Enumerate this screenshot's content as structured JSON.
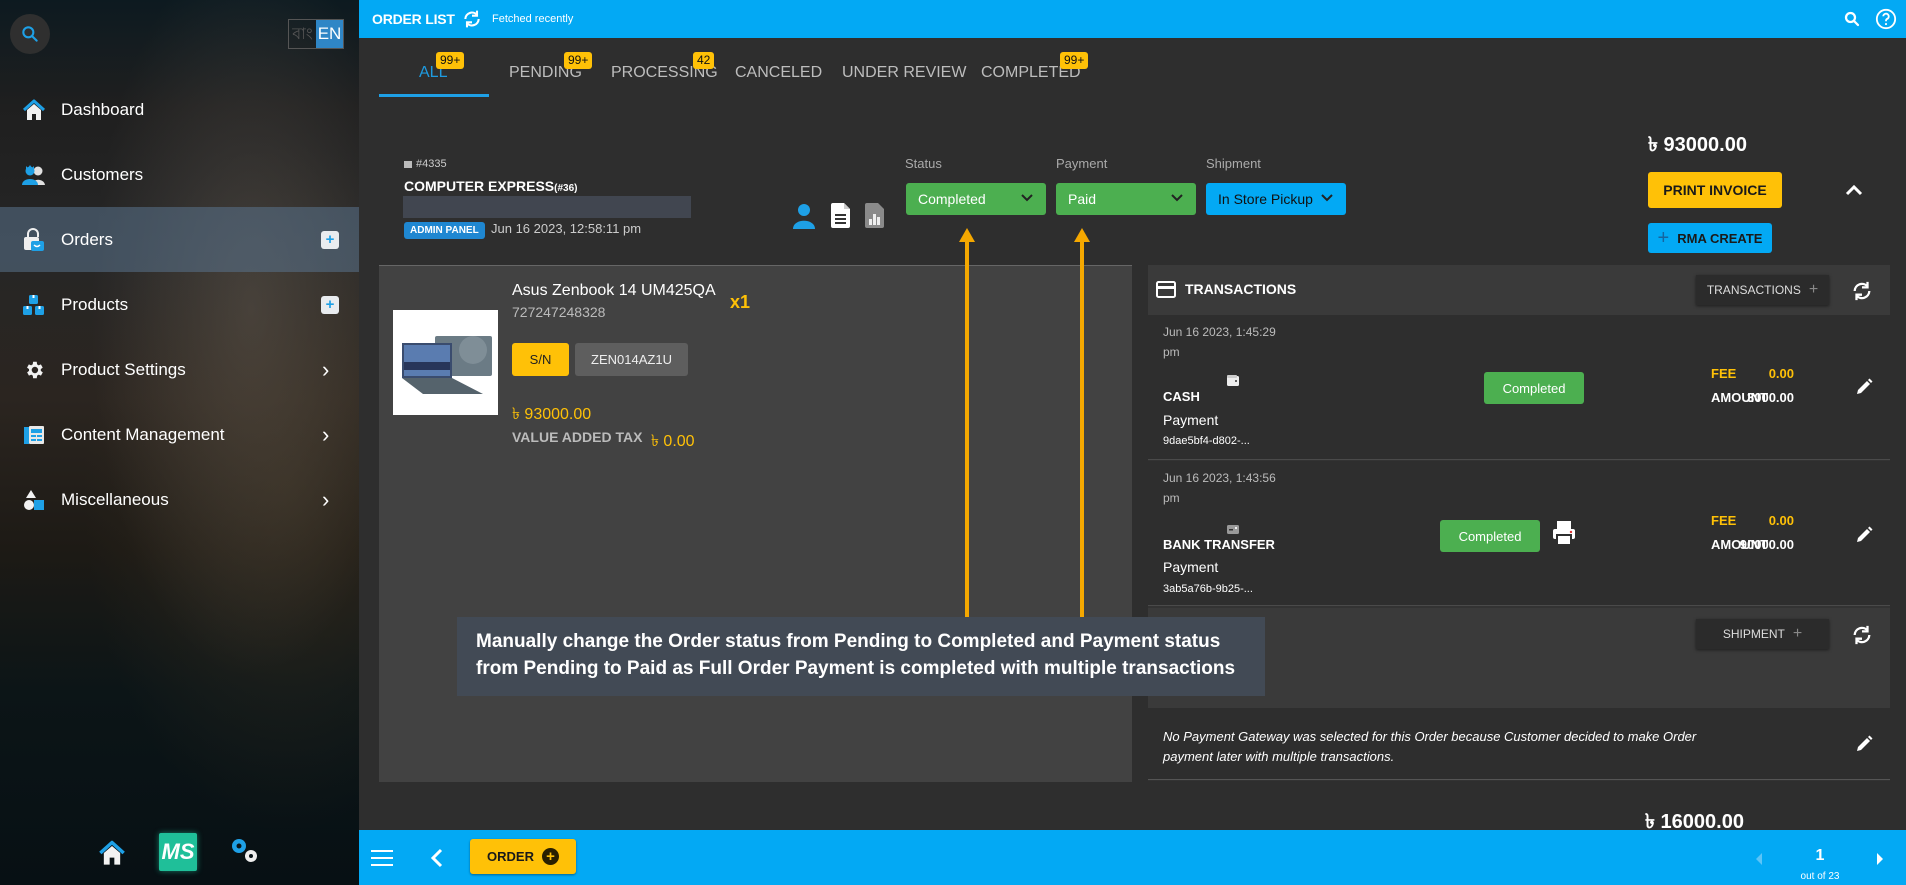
{
  "sidebar": {
    "search_icon": "search-icon",
    "lang": {
      "bn": "বাং",
      "en": "EN",
      "active": "EN"
    },
    "items": [
      {
        "label": "Dashboard",
        "icon": "home-icon",
        "action": "none"
      },
      {
        "label": "Customers",
        "icon": "customers-icon",
        "action": "none"
      },
      {
        "label": "Orders",
        "icon": "orders-bag-icon",
        "action": "add",
        "active": true
      },
      {
        "label": "Products",
        "icon": "products-boxes-icon",
        "action": "add"
      },
      {
        "label": "Product Settings",
        "icon": "gear-icon",
        "action": "expand"
      },
      {
        "label": "Content Management",
        "icon": "content-icon",
        "action": "expand"
      },
      {
        "label": "Miscellaneous",
        "icon": "shapes-icon",
        "action": "expand"
      }
    ],
    "plus_glyph": "+",
    "chevron_glyph": "›",
    "bottom": {
      "logo_text": "MS"
    }
  },
  "topbar": {
    "title": "ORDER LIST",
    "fetch_status": "Fetched recently"
  },
  "tabs": [
    {
      "label": "ALL",
      "badge": "99+",
      "active": true
    },
    {
      "label": "PENDING",
      "badge": "99+"
    },
    {
      "label": "PROCESSING",
      "badge": "42"
    },
    {
      "label": "CANCELED",
      "badge": ""
    },
    {
      "label": "UNDER REVIEW",
      "badge": ""
    },
    {
      "label": "COMPLETED",
      "badge": "99+"
    }
  ],
  "order": {
    "id": "#4335",
    "customer": "COMPUTER EXPRESS",
    "customer_id": "(#36)",
    "source": "ADMIN PANEL",
    "date": "Jun 16 2023, 12:58:11 pm",
    "status_label": "Status",
    "status": "Completed",
    "payment_label": "Payment",
    "payment": "Paid",
    "shipment_label": "Shipment",
    "shipment": "In Store Pickup",
    "total": "৳ 93000.00",
    "print_invoice": "PRINT INVOICE",
    "rma_create": "RMA CREATE",
    "colors": {
      "completed": "#4caf50",
      "shipment": "#03a9f4",
      "accent": "#ffc107"
    }
  },
  "item": {
    "name": "Asus Zenbook 14 UM425QA",
    "sku": "727247248328",
    "qty": "x1",
    "sn_label": "S/N",
    "sn_value": "ZEN014AZ1U",
    "price": "৳ 93000.00",
    "vat_label": "VALUE ADDED TAX",
    "vat_value": "৳ 0.00"
  },
  "transactions": {
    "title": "TRANSACTIONS",
    "add_label": "TRANSACTIONS",
    "rows": [
      {
        "date": "Jun 16 2023, 1:45:29 pm",
        "method": "CASH",
        "type": "Payment",
        "ref": "9dae5bf4-d802-...",
        "status": "Completed",
        "fee_label": "FEE",
        "fee": "0.00",
        "amount_label": "AMOUNT",
        "amount": "3000.00",
        "printable": false
      },
      {
        "date": "Jun 16 2023, 1:43:56 pm",
        "method": "BANK TRANSFER",
        "type": "Payment",
        "ref": "3ab5a76b-9b25-...",
        "status": "Completed",
        "fee_label": "FEE",
        "fee": "0.00",
        "amount_label": "AMOUNT",
        "amount": "90000.00",
        "printable": true
      }
    ]
  },
  "shipment": {
    "add_label": "SHIPMENT"
  },
  "note": "No Payment Gateway was selected for this Order because Customer decided to make Order payment later with multiple transactions.",
  "next_order_total": "৳ 16000.00",
  "bottombar": {
    "order_button": "ORDER",
    "page": "1",
    "page_of": "out of 23"
  },
  "annotation": {
    "text": "Manually change the Order status from Pending to Completed and Payment status from Pending to Paid as Full Order Payment is completed with multiple transactions",
    "color": "#f5a800"
  }
}
